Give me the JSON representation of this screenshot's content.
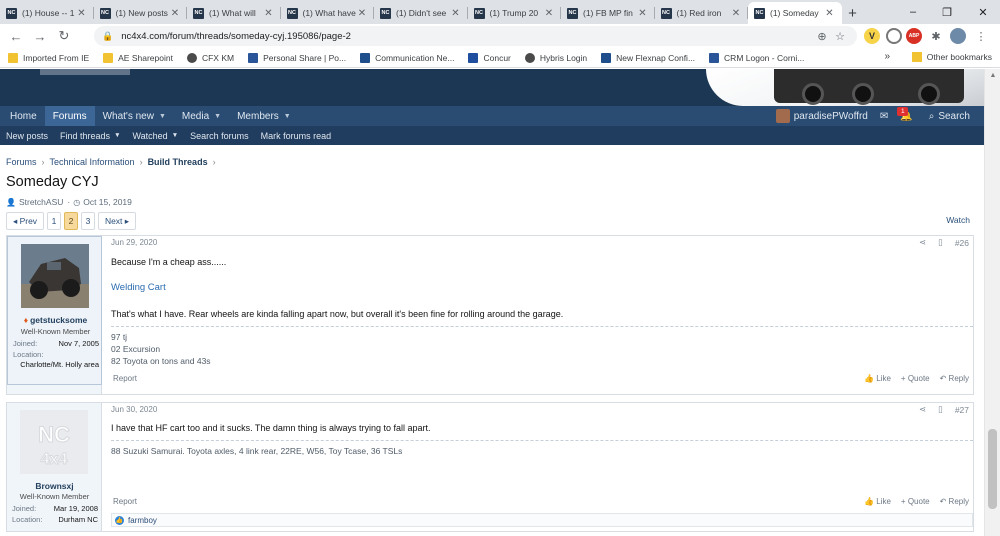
{
  "browser": {
    "tabs": [
      {
        "label": "(1) House -- 1"
      },
      {
        "label": "(1) New posts"
      },
      {
        "label": "(1) What will"
      },
      {
        "label": "(1) What have"
      },
      {
        "label": "(1) Didn't see"
      },
      {
        "label": "(1) Trump 20"
      },
      {
        "label": "(1) FB MP fin"
      },
      {
        "label": "(1) Red iron"
      },
      {
        "label": "(1) Someday",
        "active": true
      }
    ],
    "favicon_text": "NC",
    "new_tab": "+",
    "url": "nc4x4.com/forum/threads/someday-cyj.195086/page-2",
    "window_controls": {
      "minimize": "–",
      "restore": "❐",
      "close": "✕"
    }
  },
  "bookmarks": {
    "items": [
      {
        "label": "Imported From IE",
        "color": "#f1c232"
      },
      {
        "label": "AE Sharepoint",
        "color": "#f1c232"
      },
      {
        "label": "CFX KM",
        "color": "#4a4a4a"
      },
      {
        "label": "Personal Share | Po...",
        "color": "#2a5699"
      },
      {
        "label": "Communication Ne...",
        "color": "#1e4e8c"
      },
      {
        "label": "Concur",
        "color": "#1f4e9e"
      },
      {
        "label": "Hybris Login",
        "color": "#4a4a4a"
      },
      {
        "label": "New Flexnap Confi...",
        "color": "#1e4e8c"
      },
      {
        "label": "CRM Logon - Corni...",
        "color": "#2a5699"
      }
    ],
    "more": "»",
    "other": "Other bookmarks"
  },
  "site": {
    "nav": [
      {
        "label": "Home",
        "caret": false
      },
      {
        "label": "Forums",
        "caret": false,
        "active": true
      },
      {
        "label": "What's new",
        "caret": true
      },
      {
        "label": "Media",
        "caret": true
      },
      {
        "label": "Members",
        "caret": true
      }
    ],
    "username": "paradisePWoffrd",
    "alert_count": "1",
    "search_label": "Search",
    "subnav": [
      {
        "label": "New posts",
        "caret": false
      },
      {
        "label": "Find threads",
        "caret": true
      },
      {
        "label": "Watched",
        "caret": true
      },
      {
        "label": "Search forums",
        "caret": false
      },
      {
        "label": "Mark forums read",
        "caret": false
      }
    ]
  },
  "thread": {
    "breadcrumb": [
      "Forums",
      "Technical Information",
      "Build Threads"
    ],
    "title": "Someday CYJ",
    "author": "StretchASU",
    "date": "Oct 15, 2019",
    "pager": {
      "prev": "◂ Prev",
      "pages": [
        "1",
        "2",
        "3"
      ],
      "current": "2",
      "next": "Next ▸"
    },
    "watch": "Watch"
  },
  "posts": [
    {
      "date": "Jun 29, 2020",
      "number": "#26",
      "user": {
        "name": "getstucksome",
        "title": "Well-Known Member",
        "joined_label": "Joined:",
        "joined": "Nov 7, 2005",
        "location_label": "Location:",
        "location": "Charlotte/Mt. Holly area"
      },
      "text1": "Because I'm a cheap ass......",
      "link": "Welding Cart",
      "text2": "That's what I have. Rear wheels are kinda falling apart now, but overall it's been fine for rolling around the garage.",
      "signature": [
        "97 tj",
        "02 Excursion",
        "82 Toyota on tons and 43s"
      ],
      "report": "Report",
      "like": "Like",
      "quote": "+ Quote",
      "reply": "Reply"
    },
    {
      "date": "Jun 30, 2020",
      "number": "#27",
      "user": {
        "name": "Brownsxj",
        "title": "Well-Known Member",
        "joined_label": "Joined:",
        "joined": "Mar 19, 2008",
        "location_label": "Location:",
        "location": "Durham NC",
        "avatar_text": "NC 4x4"
      },
      "text1": "I have that HF cart too and it sucks. The damn thing is always trying to fall apart.",
      "signature": [
        "88 Suzuki Samurai. Toyota axles, 4 link rear, 22RE, W56, Toy Tcase, 36 TSLs"
      ],
      "report": "Report",
      "like": "Like",
      "quote": "+ Quote",
      "reply": "Reply",
      "liked_by": "farmboy"
    }
  ]
}
